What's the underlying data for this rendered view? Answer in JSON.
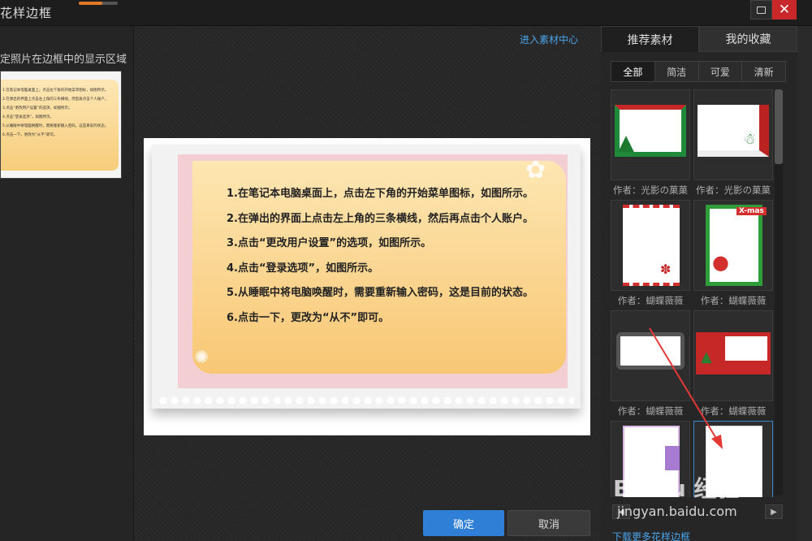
{
  "window": {
    "title": "花样边框",
    "progress": 0.6,
    "close_glyph": "✕"
  },
  "left": {
    "hint": "定照片在边框中的显示区域",
    "thumb_lines": [
      "1.在笔记本电脑桌面上，点击左下角的开始菜单图标，如图所示。",
      "2.在弹出的界面上点击左上角的三条横线，然后再点击个人账户。",
      "3.点击“更改用户设置”的选项，如图所示。",
      "4.点击“登录选项”，如图所示。",
      "5.从睡眠中将电脑唤醒时，需要重新输入密码，这是目前的状态。",
      "6.点击一下，更改为“从不”即可。"
    ]
  },
  "center": {
    "material_center_link": "进入素材中心",
    "lines": [
      "1.在笔记本电脑桌面上，点击左下角的开始菜单图标，如图所示。",
      "2.在弹出的界面上点击左上角的三条横线，然后再点击个人账户。",
      "3.点击“更改用户设置”的选项，如图所示。",
      "4.点击“登录选项”，如图所示。",
      "5.从睡眠中将电脑唤醒时，需要重新输入密码，这是目前的状态。",
      "6.点击一下，更改为“从不”即可。"
    ],
    "ok_label": "确定",
    "cancel_label": "取消"
  },
  "right": {
    "tabs": [
      "推荐素材",
      "我的收藏"
    ],
    "filters": [
      "全部",
      "简洁",
      "可爱",
      "清新"
    ],
    "authors": [
      "作者：光影の菓菓",
      "作者：光影の菓菓",
      "作者：蝴蝶薇薇",
      "作者：蝴蝶薇薇",
      "作者：蝴蝶薇薇",
      "作者：蝴蝶薇薇"
    ],
    "xmas_text": "X-mas",
    "download_link": "下载更多花样边框"
  },
  "watermark": {
    "brand": "Baidu 经验",
    "url": "jingyan.baidu.com"
  },
  "colors": {
    "accent": "#2f7fd6",
    "link": "#4aa3e8",
    "close": "#c8282a",
    "annotation_arrow": "#e53935"
  }
}
